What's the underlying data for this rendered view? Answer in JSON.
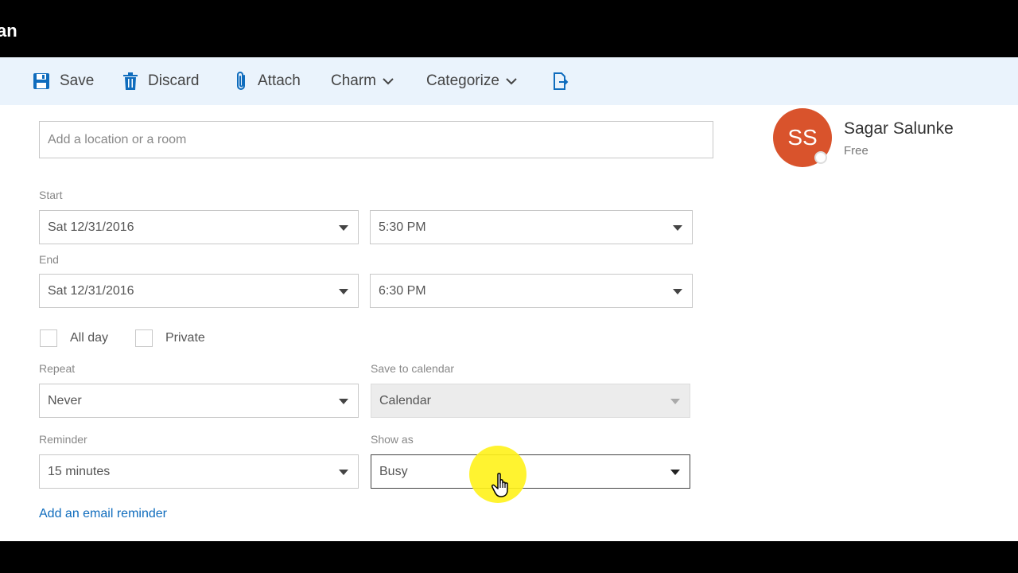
{
  "window": {
    "title_fragment": "an"
  },
  "toolbar": {
    "save_label": "Save",
    "discard_label": "Discard",
    "attach_label": "Attach",
    "charm_label": "Charm",
    "categorize_label": "Categorize",
    "icons": {
      "save": "floppy-disk-icon",
      "discard": "trash-icon",
      "attach": "paperclip-icon",
      "extra": "document-export-icon"
    },
    "accent_color": "#0f6cbd"
  },
  "location": {
    "placeholder": "Add a location or a room",
    "value": ""
  },
  "start": {
    "label": "Start",
    "date": "Sat 12/31/2016",
    "time": "5:30 PM"
  },
  "end": {
    "label": "End",
    "date": "Sat 12/31/2016",
    "time": "6:30 PM"
  },
  "options": {
    "all_day_label": "All day",
    "private_label": "Private",
    "all_day_checked": false,
    "private_checked": false
  },
  "repeat": {
    "label": "Repeat",
    "value": "Never"
  },
  "save_to_calendar": {
    "label": "Save to calendar",
    "value": "Calendar"
  },
  "reminder": {
    "label": "Reminder",
    "value": "15 minutes"
  },
  "show_as": {
    "label": "Show as",
    "value": "Busy"
  },
  "email_reminder_link": "Add an email reminder",
  "attendee": {
    "initials": "SS",
    "name": "Sagar Salunke",
    "status": "Free",
    "avatar_color": "#d9532c"
  }
}
